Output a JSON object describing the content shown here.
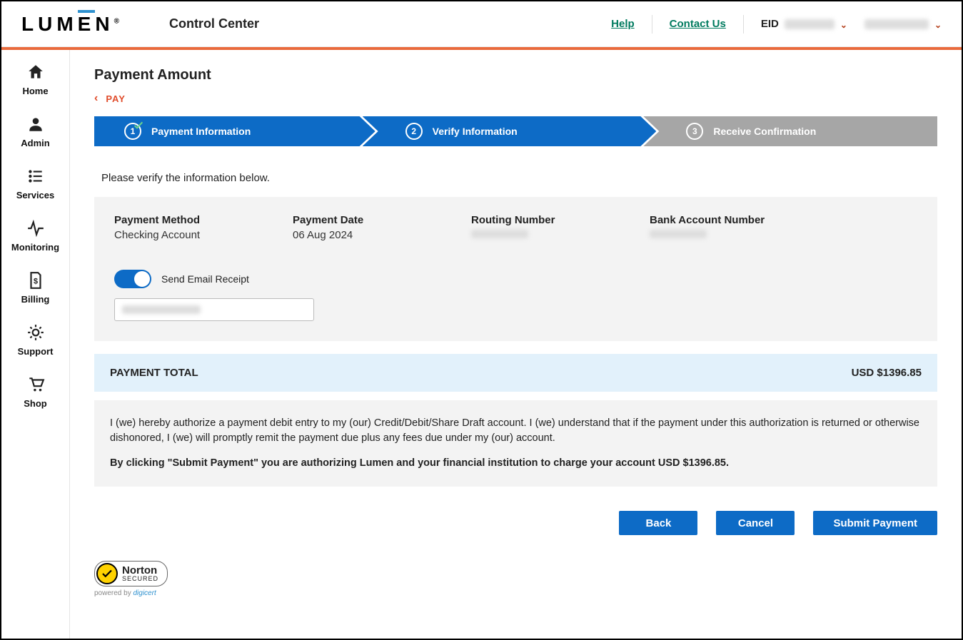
{
  "header": {
    "app_name_left": "LUM",
    "app_name_right": "N",
    "app_title": "Control Center",
    "help": "Help",
    "contact": "Contact Us",
    "eid_label": "EID"
  },
  "sidebar": {
    "items": [
      {
        "label": "Home"
      },
      {
        "label": "Admin"
      },
      {
        "label": "Services"
      },
      {
        "label": "Monitoring"
      },
      {
        "label": "Billing"
      },
      {
        "label": "Support"
      },
      {
        "label": "Shop"
      }
    ]
  },
  "page": {
    "title": "Payment Amount",
    "breadcrumb": "PAY"
  },
  "steps": {
    "s1": "Payment Information",
    "s2": "Verify Information",
    "s3": "Receive Confirmation"
  },
  "verify": {
    "intro": "Please verify the information below.",
    "payment_method_label": "Payment Method",
    "payment_method_value": "Checking Account",
    "payment_date_label": "Payment Date",
    "payment_date_value": "06 Aug 2024",
    "routing_label": "Routing Number",
    "account_label": "Bank Account Number",
    "send_receipt_label": "Send Email Receipt"
  },
  "total": {
    "label": "PAYMENT TOTAL",
    "value": "USD $1396.85"
  },
  "disclaimer": {
    "p1": "I (we) hereby authorize a payment debit entry to my (our) Credit/Debit/Share Draft account. I (we) understand that if the payment under this authorization is returned or otherwise dishonored, I (we) will promptly remit the payment due plus any fees due under my (our) account.",
    "p2": "By clicking \"Submit Payment\" you are authorizing Lumen and your financial institution to charge your account USD $1396.85."
  },
  "buttons": {
    "back": "Back",
    "cancel": "Cancel",
    "submit": "Submit Payment"
  },
  "norton": {
    "t1": "Norton",
    "t2": "SECURED",
    "sub_prefix": "powered by ",
    "sub_brand": "digicert"
  }
}
